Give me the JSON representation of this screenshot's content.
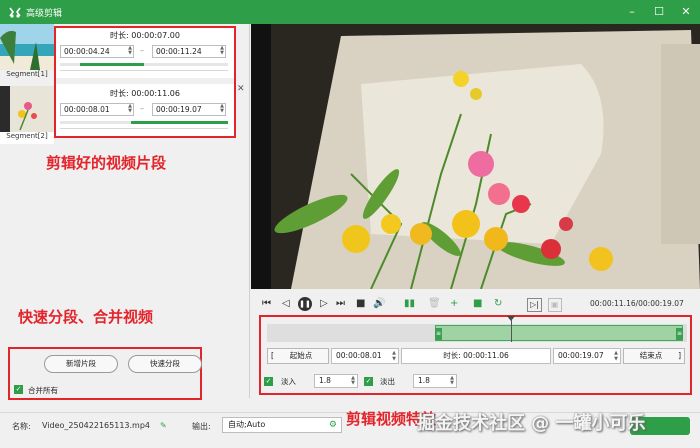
{
  "titlebar": {
    "title": "高级剪辑",
    "minimize_icon": "minimize-icon",
    "maximize_icon": "maximize-icon",
    "close_icon": "close-icon",
    "accent": "#2f9e48"
  },
  "segments": [
    {
      "label": "Segment[1]",
      "duration_label": "时长: 00:00:07.00",
      "start": "00:00:04.24",
      "end": "00:00:11.24",
      "progress_start": 0.12,
      "progress_end": 0.5
    },
    {
      "label": "Segment[2]",
      "duration_label": "时长: 00:00:11.06",
      "start": "00:00:08.01",
      "end": "00:00:19.07",
      "progress_start": 0.42,
      "progress_end": 1.0
    }
  ],
  "annotations": {
    "clips": "剪辑好的视频片段",
    "split_merge": "快速分段、合并视频",
    "effects": "剪辑视频特效"
  },
  "left_buttons": {
    "new_segment": "新增片段",
    "quick_split": "快速分段",
    "merge_all": "合并所有"
  },
  "player": {
    "time": "00:00:11.16/00:00:19.07",
    "buttons": [
      "skip-start-icon",
      "prev-frame-icon",
      "pause-icon",
      "next-frame-icon",
      "skip-end-icon",
      "stop-icon",
      "volume-icon",
      "split-icon",
      "delete-icon",
      "add-icon",
      "copy-icon",
      "reset-icon",
      "mark-in-icon",
      "mark-out-icon"
    ],
    "timeline_selection": {
      "start": 0.4,
      "end": 1.0,
      "playhead": 0.58
    }
  },
  "range": {
    "start_btn": "起始点",
    "start_value": "00:00:08.01",
    "duration": "时长: 00:00:11.06",
    "end_value": "00:00:19.07",
    "end_btn": "结束点",
    "bracket_open": "[",
    "bracket_close": "]"
  },
  "fade": {
    "fade_in_label": "淡入",
    "fade_in_value": "1.8",
    "fade_out_label": "淡出",
    "fade_out_value": "1.8"
  },
  "bottom": {
    "name_label": "名称:",
    "name_value": "Video_250422165113.mp4",
    "output_label": "输出:",
    "output_value": "自动;Auto",
    "watermark": "掘金技术社区 @ 一罐小可乐"
  }
}
